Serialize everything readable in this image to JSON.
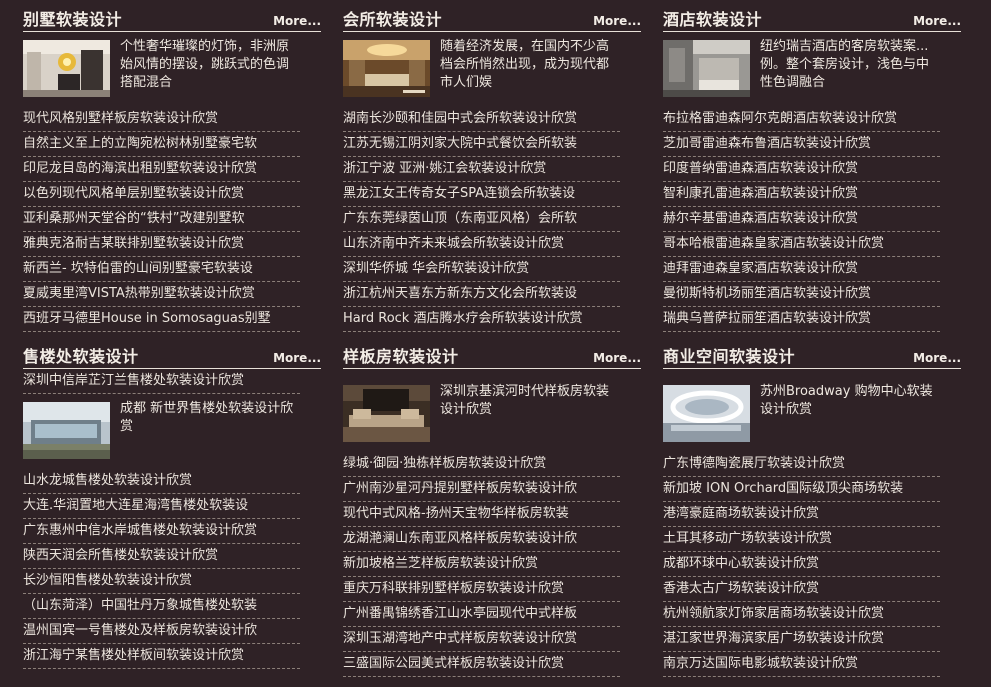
{
  "more_label": "More...",
  "sections": {
    "villa": {
      "title": "别墅软装设计",
      "feature": "个性奢华璀璨的灯饰，非洲原始风情的摆设，跳跃式的色调搭配混合",
      "items": [
        "现代风格别墅样板房软装设计欣赏",
        "自然主义至上的立陶宛松树林别墅豪宅软",
        "印尼龙目岛的海滨出租别墅软装设计欣赏",
        "以色列现代风格单层别墅软装设计欣赏",
        "亚利桑那州天堂谷的“铁村”改建别墅软",
        "雅典克洛耐吉某联排别墅软装设计欣赏",
        "新西兰- 坎特伯雷的山间别墅豪宅软装设",
        "夏威夷里湾VISTA热带别墅软装设计欣赏",
        "西班牙马德里House in Somosaguas别墅"
      ]
    },
    "club": {
      "title": "会所软装设计",
      "feature": "随着经济发展，在国内不少高档会所悄然出现，成为现代都市人们娱",
      "items": [
        "湖南长沙颐和佳园中式会所软装设计欣赏",
        "江苏无锡江阴刘家大院中式餐饮会所软装",
        "浙江宁波 亚洲·姚江会软装设计欣赏",
        "黑龙江女王传奇女子SPA连锁会所软装设",
        "广东东莞绿茵山顶（东南亚风格）会所软",
        "山东济南中齐未来城会所软装设计欣赏",
        "深圳华侨城 华会所软装设计欣赏",
        "浙江杭州天喜东方新东方文化会所软装设",
        "Hard Rock 酒店腾水疗会所软装设计欣赏"
      ]
    },
    "hotel": {
      "title": "酒店软装设计",
      "feature": "纽约瑞吉酒店的客房软装案...例。整个套房设计，浅色与中性色调融合",
      "items": [
        "布拉格雷迪森阿尔克朗酒店软装设计欣赏",
        "芝加哥雷迪森布鲁酒店软装设计欣赏",
        "印度普纳雷迪森酒店软装设计欣赏",
        "智利康孔雷迪森酒店软装设计欣赏",
        "赫尔辛基雷迪森酒店软装设计欣赏",
        "哥本哈根雷迪森皇家酒店软装设计欣赏",
        "迪拜雷迪森皇家酒店软装设计欣赏",
        "曼彻斯特机场丽笙酒店软装设计欣赏",
        "瑞典乌普萨拉丽笙酒店软装设计欣赏"
      ]
    },
    "sales": {
      "title": "售楼处软装设计",
      "top_item": "深圳中信岸芷汀兰售楼处软装设计欣赏",
      "feature": "成都 新世界售楼处软装设计欣赏",
      "items": [
        "山水龙城售楼处软装设计欣赏",
        "大连.华润置地大连星海湾售楼处软装设",
        "广东惠州中信水岸城售楼处软装设计欣赏",
        "陕西天润会所售楼处软装设计欣赏",
        "长沙恒阳售楼处软装设计欣赏",
        "（山东菏泽）中国牡丹万象城售楼处软装",
        "温州国宾一号售楼处及样板房软装设计欣",
        "浙江海宁某售楼处样板间软装设计欣赏"
      ]
    },
    "showroom": {
      "title": "样板房软装设计",
      "feature": "深圳京基滨河时代样板房软装设计欣赏",
      "items": [
        "绿城·御园·独栋样板房软装设计欣赏",
        "广州南沙星河丹提别墅样板房软装设计欣",
        "现代中式风格-扬州天宝物华样板房软装",
        "龙湖滟澜山东南亚风格样板房软装设计欣",
        "新加坡格兰芝样板房软装设计欣赏",
        "重庆万科联排别墅样板房软装设计欣赏",
        "广州番禺锦绣香江山水亭园现代中式样板",
        "深圳玉湖湾地产中式样板房软装设计欣赏",
        "三盛国际公园美式样板房软装设计欣赏"
      ]
    },
    "commercial": {
      "title": "商业空间软装设计",
      "feature": "苏州Broadway 购物中心软装设计欣赏",
      "items": [
        "广东博德陶瓷展厅软装设计欣赏",
        "新加坡 ION Orchard国际级顶尖商场软装",
        "港湾豪庭商场软装设计欣赏",
        "土耳其移动广场软装设计欣赏",
        "成都环球中心软装设计欣赏",
        "香港太古广场软装设计欣赏",
        "杭州领航家灯饰家居商场软装设计欣赏",
        "湛江家世界海滨家居广场软装设计欣赏",
        "南京万达国际电影城软装设计欣赏"
      ]
    }
  }
}
